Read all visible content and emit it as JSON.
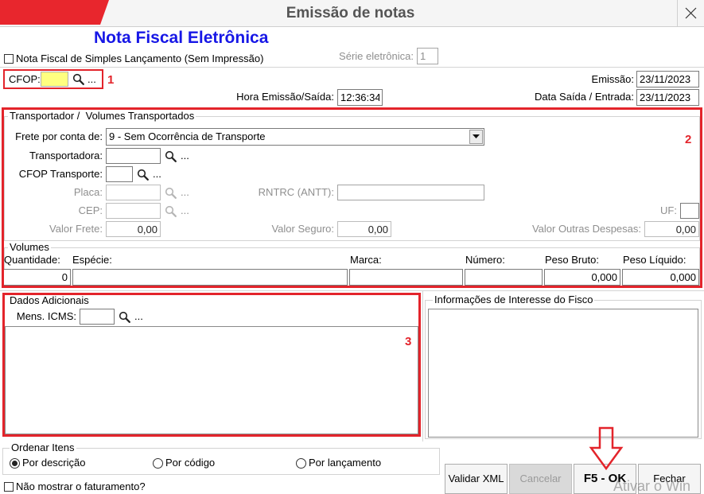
{
  "colors": {
    "annotation_red": "#e3242b",
    "brand_red": "#e8262d",
    "title_blue": "#1717e6",
    "cfop_highlight": "#ffff80",
    "disabled_text": "#8f8f8f"
  },
  "icons": {
    "lookup": "search-icon",
    "close": "close-icon",
    "dropdown": "chevron-down-icon",
    "annotation_arrow": "arrow-down-icon"
  },
  "window": {
    "title": "Emissão de notas"
  },
  "header": {
    "title": "Nota Fiscal Eletrônica",
    "simples_label": "Nota Fiscal de Simples Lançamento (Sem Impressão)",
    "simples_checked": false,
    "serie_label": "Série eletrônica:",
    "serie_value": "1"
  },
  "cfop": {
    "label": "CFOP:",
    "value": "",
    "lookup_more": "..."
  },
  "dates": {
    "emissao_label": "Emissão:",
    "emissao_value": "23/11/2023",
    "hora_label": "Hora Emissão/Saída:",
    "hora_value": "12:36:34",
    "saida_label": "Data Saída / Entrada:",
    "saida_value": "23/11/2023"
  },
  "transport": {
    "group_label": "Transportador /  Volumes Transportados",
    "frete_label": "Frete por conta de:",
    "frete_value": "9 - Sem Ocorrência de Transporte",
    "transportadora_label": "Transportadora:",
    "transportadora_value": "",
    "cfop_transporte_label": "CFOP Transporte:",
    "cfop_transporte_value": "",
    "placa_label": "Placa:",
    "placa_value": "",
    "rntrc_label": "RNTRC (ANTT):",
    "rntrc_value": "",
    "cep_label": "CEP:",
    "cep_value": "",
    "uf_label": "UF:",
    "uf_value": "",
    "valor_frete_label": "Valor Frete:",
    "valor_frete_value": "0,00",
    "valor_seguro_label": "Valor Seguro:",
    "valor_seguro_value": "0,00",
    "valor_outras_label": "Valor Outras Despesas:",
    "valor_outras_value": "0,00",
    "lookup_more": "..."
  },
  "volumes": {
    "group_label": "Volumes",
    "columns": [
      {
        "label": "Quantidade:",
        "value": "0"
      },
      {
        "label": "Espécie:",
        "value": ""
      },
      {
        "label": "Marca:",
        "value": ""
      },
      {
        "label": "Número:",
        "value": ""
      },
      {
        "label": "Peso Bruto:",
        "value": "0,000"
      },
      {
        "label": "Peso Líquido:",
        "value": "0,000"
      }
    ]
  },
  "dados_adicionais": {
    "group_label": "Dados Adicionais",
    "mens_icms_label": "Mens. ICMS:",
    "mens_icms_value": "",
    "lookup_more": "...",
    "text": ""
  },
  "fisco": {
    "group_label": "Informações de Interesse do Fisco",
    "text": ""
  },
  "ordenar": {
    "group_label": "Ordenar Itens",
    "options": [
      "Por descrição",
      "Por código",
      "Por lançamento"
    ],
    "selected": "Por descrição"
  },
  "nao_mostrar": {
    "label": "Não mostrar o faturamento?",
    "checked": false
  },
  "buttons": {
    "validar_xml": "Validar XML",
    "cancelar": "Cancelar",
    "cancelar_enabled": false,
    "ok": "F5 - OK",
    "fechar": "Fechar"
  },
  "annotations": {
    "marker_1": "1",
    "marker_2": "2",
    "marker_3": "3"
  },
  "watermark": "Ativar o Win"
}
